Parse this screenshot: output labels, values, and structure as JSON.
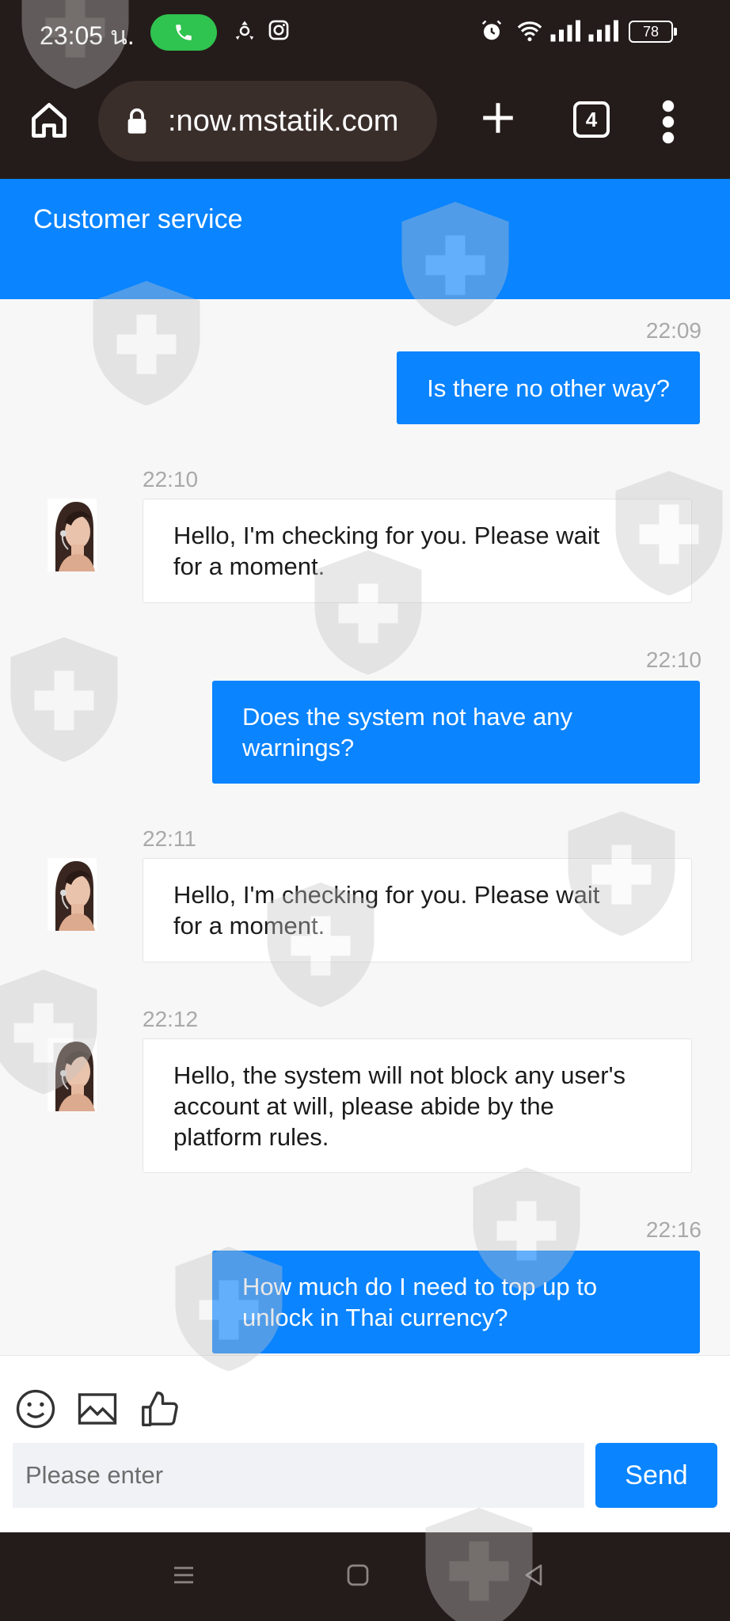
{
  "status_bar": {
    "time": "23:05 น.",
    "battery": "78"
  },
  "browser": {
    "url": ":now.mstatik.com",
    "tab_count": "4"
  },
  "header": {
    "title": "Customer service"
  },
  "messages": [
    {
      "direction": "outgoing",
      "time": "22:09",
      "lines": [
        "Is there no other way?"
      ]
    },
    {
      "direction": "incoming",
      "time": "22:10",
      "lines": [
        "Hello, I'm checking for you. Please wait",
        "for a moment."
      ]
    },
    {
      "direction": "outgoing",
      "time": "22:10",
      "lines": [
        "Does the system not have any",
        "warnings?"
      ]
    },
    {
      "direction": "incoming",
      "time": "22:11",
      "lines": [
        "Hello, I'm checking for you. Please wait",
        "for a moment."
      ]
    },
    {
      "direction": "incoming",
      "time": "22:12",
      "lines": [
        "Hello, the system will not block any user's",
        "account at will, please abide by the",
        "platform rules."
      ]
    },
    {
      "direction": "outgoing",
      "time": "22:16",
      "lines": [
        "How much do I need to top up to",
        "unlock in Thai currency?"
      ]
    }
  ],
  "composer": {
    "placeholder": "Please enter",
    "value": "",
    "send_label": "Send",
    "icons": [
      "emoji-icon",
      "image-icon",
      "thumbs-up-icon"
    ]
  },
  "nav_bar": {
    "icons": [
      "recents-icon",
      "home-icon",
      "back-icon"
    ]
  },
  "colors": {
    "accent": "#0a84ff",
    "system_bar": "#241c1a",
    "chat_background": "#f7f7f7"
  }
}
